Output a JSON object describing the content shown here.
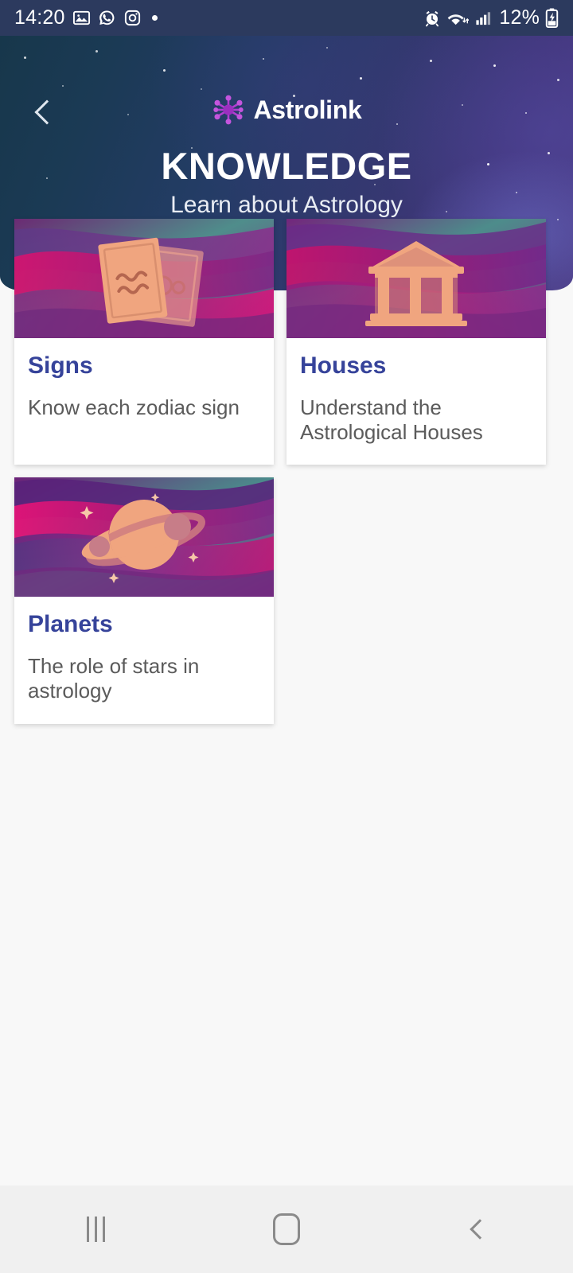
{
  "status_bar": {
    "time": "14:20",
    "battery_percent": "12%",
    "left_icons": [
      "gallery-icon",
      "whatsapp-icon",
      "instagram-icon",
      "notification-dot-icon"
    ],
    "right_icons": [
      "alarm-icon",
      "wifi-icon",
      "signal-icon",
      "battery-charging-icon"
    ],
    "background_color": "#2c3a5e"
  },
  "header": {
    "back_icon": "chevron-left-icon",
    "brand_name": "Astrolink",
    "brand_icon": "astrolink-molecule-logo",
    "title": "KNOWLEDGE",
    "subtitle": "Learn about Astrology",
    "accent_color": "#9b35b8"
  },
  "cards": [
    {
      "title": "Signs",
      "description": "Know each zodiac sign",
      "art": "zodiac-cards-illustration"
    },
    {
      "title": "Houses",
      "description": "Understand the Astrological Houses",
      "art": "greek-temple-illustration"
    },
    {
      "title": "Planets",
      "description": "The role of stars in astrology",
      "art": "saturn-planet-illustration"
    }
  ],
  "theme": {
    "card_title_color": "#36439a",
    "card_desc_color": "#5b5b5b",
    "page_background": "#f8f8f8"
  },
  "nav_bar": {
    "recents_label": "recents-icon",
    "home_label": "home-icon",
    "back_label": "back-icon"
  }
}
